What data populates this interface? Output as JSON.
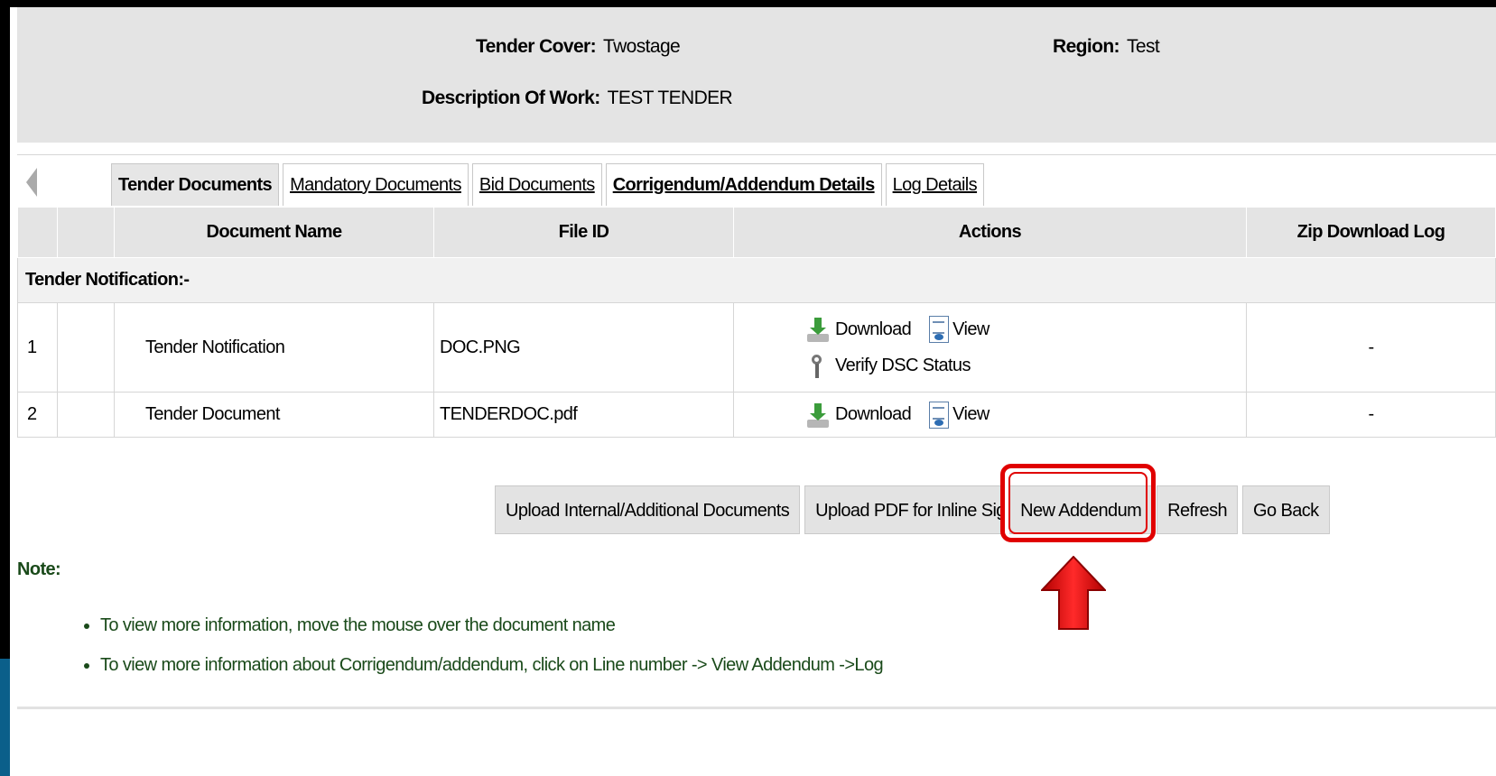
{
  "header": {
    "tender_cover_label": "Tender Cover:",
    "tender_cover_value": "Twostage",
    "region_label": "Region:",
    "region_value": "Test",
    "description_label": "Description Of Work:",
    "description_value": "TEST TENDER"
  },
  "tabs": [
    {
      "label": "Tender Documents",
      "active": true
    },
    {
      "label": "Mandatory Documents"
    },
    {
      "label": "Bid Documents"
    },
    {
      "label": "Corrigendum/Addendum Details"
    },
    {
      "label": "Log Details"
    }
  ],
  "table": {
    "columns": [
      "",
      "",
      "Document Name",
      "File ID",
      "Actions",
      "Zip Download Log"
    ],
    "section_title": "Tender Notification:-",
    "rows": [
      {
        "no": "1",
        "name": "Tender Notification",
        "file_id": "DOC.PNG",
        "actions": [
          "Download",
          "View",
          "Verify DSC Status"
        ],
        "zip_log": "-"
      },
      {
        "no": "2",
        "name": "Tender Document",
        "file_id": "TENDERDOC.pdf",
        "actions": [
          "Download",
          "View"
        ],
        "zip_log": "-"
      }
    ]
  },
  "buttons": {
    "upload_internal": "Upload Internal/Additional Documents",
    "upload_pdf": "Upload PDF for Inline Sign",
    "new_addendum": "New Addendum",
    "refresh": "Refresh",
    "go_back": "Go Back"
  },
  "note": {
    "label": "Note:",
    "items": [
      "To view more information, move the mouse over the document name",
      "To view more information about Corrigendum/addendum, click on Line number -> View Addendum ->Log"
    ]
  },
  "colors": {
    "highlight": "#e00000",
    "panel": "#e4e4e4",
    "note_text": "#1a4a1a"
  },
  "icons": [
    "download-icon",
    "view-document-icon",
    "dsc-certificate-icon",
    "tab-scroll-left-icon",
    "red-arrow-indicator"
  ]
}
